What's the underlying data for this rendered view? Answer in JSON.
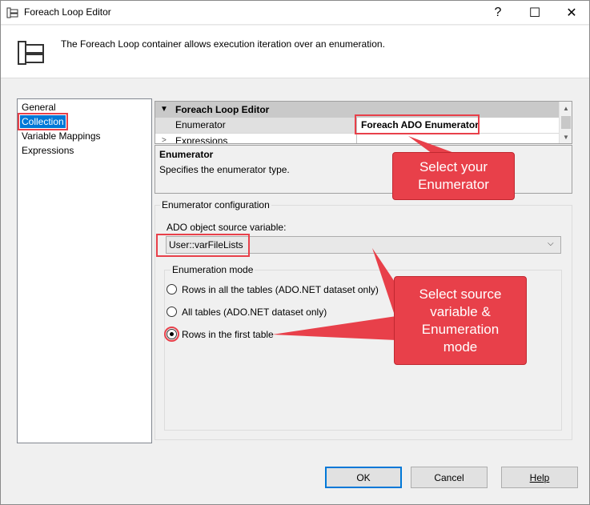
{
  "window": {
    "title": "Foreach Loop Editor",
    "help_glyph": "?",
    "maximize_glyph": "☐",
    "close_glyph": "✕"
  },
  "header": {
    "description": "The Foreach Loop container allows execution iteration over an enumeration."
  },
  "nav": {
    "items": [
      "General",
      "Collection",
      "Variable Mappings",
      "Expressions"
    ],
    "selected": "Collection"
  },
  "property_grid": {
    "category": "Foreach Loop Editor",
    "rows": [
      {
        "name": "Enumerator",
        "value": "Foreach ADO Enumerator"
      },
      {
        "name": "Expressions",
        "value": ""
      }
    ]
  },
  "description": {
    "title": "Enumerator",
    "text": "Specifies the enumerator type."
  },
  "config": {
    "group_label": "Enumerator configuration",
    "source_label": "ADO object source variable:",
    "source_value": "User::varFileLists",
    "mode_label": "Enumeration mode",
    "modes": [
      "Rows in all the tables (ADO.NET dataset only)",
      "All tables (ADO.NET dataset only)",
      "Rows in the first table"
    ],
    "selected_mode_index": 2
  },
  "buttons": {
    "ok": "OK",
    "cancel": "Cancel",
    "help": "Help"
  },
  "callouts": {
    "enumerator": "Select your Enumerator",
    "source": "Select source variable & Enumeration mode"
  },
  "colors": {
    "accent": "#0078d7",
    "callout": "#e8404a"
  }
}
